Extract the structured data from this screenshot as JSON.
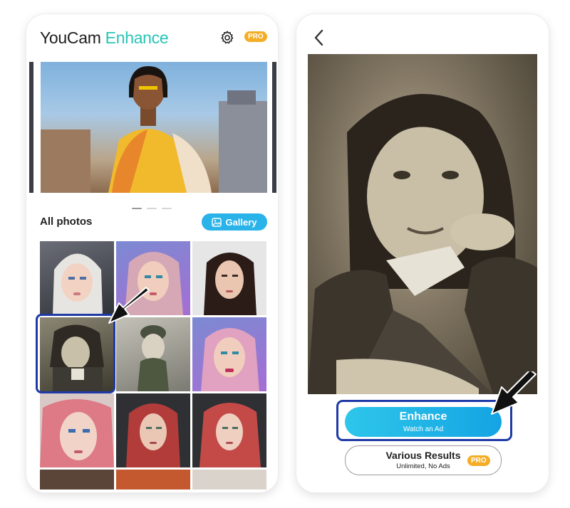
{
  "left_screen": {
    "app_name_part1": "YouCam",
    "app_name_part2": "Enhance",
    "pro_badge": "PRO",
    "section_title": "All photos",
    "gallery_button": "Gallery",
    "carousel_pages": 3,
    "carousel_active_index": 0,
    "photos_count_visible": 12,
    "selected_photo_index": 3
  },
  "right_screen": {
    "enhance_button": {
      "label": "Enhance",
      "sublabel": "Watch an Ad"
    },
    "various_button": {
      "label": "Various Results",
      "sublabel": "Unlimited, No Ads",
      "badge": "PRO"
    }
  },
  "colors": {
    "accent_teal": "#27c5b5",
    "gallery_blue": "#2ab3e8",
    "pro_orange": "#f4ad26",
    "highlight_navy": "#1f3aa6"
  },
  "icons": [
    "gear-icon",
    "image-icon",
    "back-chevron-icon",
    "pointer-arrow-icon"
  ]
}
